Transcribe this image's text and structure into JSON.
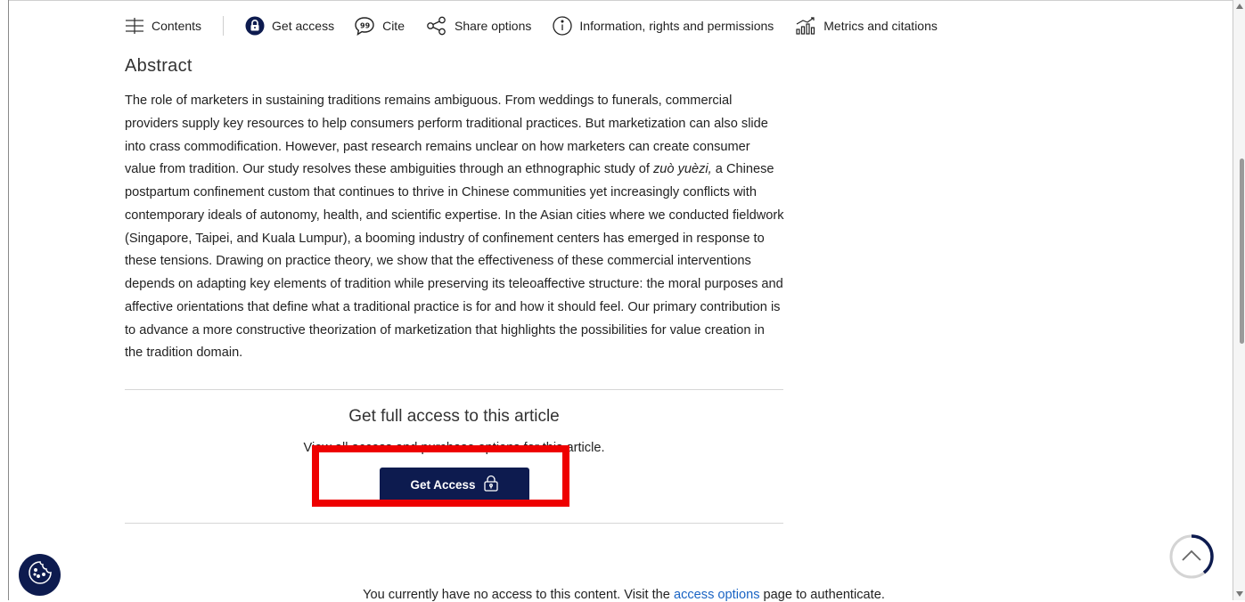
{
  "toolbar": {
    "contents": {
      "label": "Contents",
      "icon": "contents-icon"
    },
    "get_access": {
      "label": "Get access",
      "icon": "lock-icon"
    },
    "cite": {
      "label": "Cite",
      "icon": "quote-icon"
    },
    "share": {
      "label": "Share options",
      "icon": "share-icon"
    },
    "info": {
      "label": "Information, rights and permissions",
      "icon": "info-icon"
    },
    "metrics": {
      "label": "Metrics and citations",
      "icon": "metrics-icon"
    }
  },
  "abstract": {
    "heading": "Abstract",
    "text_before": "The role of marketers in sustaining traditions remains ambiguous. From weddings to funerals, commercial providers supply key resources to help consumers perform traditional practices. But marketization can also slide into crass commodification. However, past research remains unclear on how marketers can create consumer value from tradition. Our study resolves these ambiguities through an ethnographic study of ",
    "italic_term": "zuò yuèzi,",
    "text_after": " a Chinese postpartum confinement custom that continues to thrive in Chinese communities yet increasingly conflicts with contemporary ideals of autonomy, health, and scientific expertise. In the Asian cities where we conducted fieldwork (Singapore, Taipei, and Kuala Lumpur), a booming industry of confinement centers has emerged in response to these tensions. Drawing on practice theory, we show that the effectiveness of these commercial interventions depends on adapting key elements of tradition while preserving its teleoaffective structure: the moral purposes and affective orientations that define what a traditional practice is for and how it should feel. Our primary contribution is to advance a more constructive theorization of marketization that highlights the possibilities for value creation in the tradition domain."
  },
  "access": {
    "title": "Get full access to this article",
    "description": "View all access and purchase options for this article.",
    "button_label": "Get Access"
  },
  "notice": {
    "before": "You currently have no access to this content. Visit the ",
    "link": "access options",
    "after": " page to authenticate."
  },
  "colors": {
    "brand_navy": "#0d1b4f",
    "highlight_red": "#ee0000",
    "link_blue": "#1a64c4"
  }
}
